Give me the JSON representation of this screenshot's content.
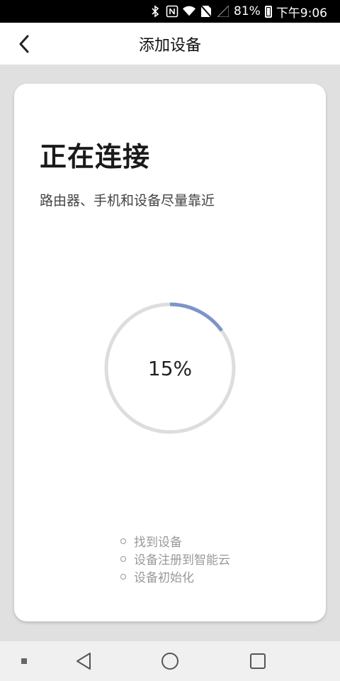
{
  "status_bar": {
    "battery": "81%",
    "time": "下午9:06",
    "icons": [
      "bluetooth-icon",
      "nfc-icon",
      "wifi-icon",
      "no-sim-icon",
      "signal-icon",
      "battery-icon"
    ]
  },
  "app_bar": {
    "title": "添加设备",
    "back_icon": "chevron-left-icon"
  },
  "card": {
    "title": "正在连接",
    "subtitle": "路由器、手机和设备尽量靠近",
    "progress": {
      "value": 15,
      "label": "15%",
      "track_color": "#dddddd",
      "fill_color": "#7b95c9"
    },
    "steps": [
      {
        "label": "找到设备"
      },
      {
        "label": "设备注册到智能云"
      },
      {
        "label": "设备初始化"
      }
    ]
  },
  "nav_bar": {
    "buttons": [
      "recents-dot-icon",
      "back-triangle-icon",
      "home-circle-icon",
      "overview-square-icon"
    ]
  }
}
